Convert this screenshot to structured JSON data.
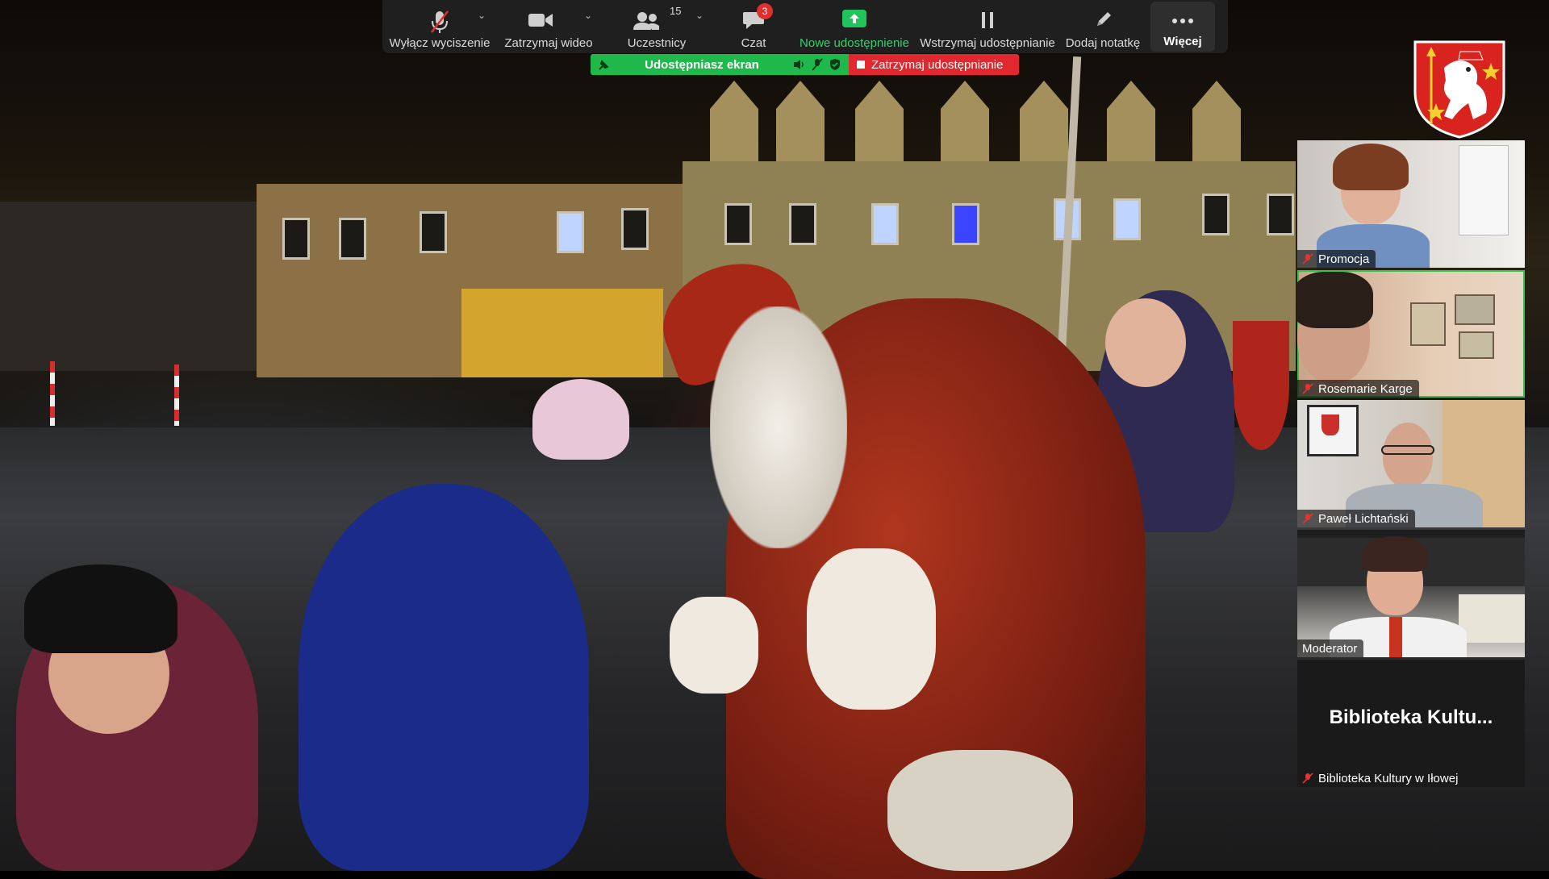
{
  "toolbar": {
    "mute": {
      "label": "Wyłącz wyciszenie",
      "icon": "microphone-muted-icon"
    },
    "video": {
      "label": "Zatrzymaj wideo",
      "icon": "video-camera-icon"
    },
    "participants": {
      "label": "Uczestnicy",
      "count": "15",
      "icon": "participants-icon"
    },
    "chat": {
      "label": "Czat",
      "badge": "3",
      "icon": "chat-icon"
    },
    "new_share": {
      "label": "Nowe udostępnienie",
      "icon": "share-arrow-icon"
    },
    "pause_share": {
      "label": "Wstrzymaj udostępnianie",
      "icon": "pause-icon"
    },
    "annotate": {
      "label": "Dodaj notatkę",
      "icon": "pencil-icon"
    },
    "more": {
      "label": "Więcej",
      "icon": "more-dots-icon"
    }
  },
  "share_banner": {
    "status": "Udostępniasz ekran",
    "stop_label": "Zatrzymaj udostępnianie"
  },
  "participants": [
    {
      "name": "Promocja",
      "muted": true,
      "active_speaker": false
    },
    {
      "name": "Rosemarie Karge",
      "muted": true,
      "active_speaker": true
    },
    {
      "name": "Paweł Lichtański",
      "muted": true,
      "active_speaker": false
    },
    {
      "name": "Moderator",
      "muted": false,
      "active_speaker": false
    },
    {
      "name": "Biblioteka Kultury w Iłowej",
      "display": "Biblioteka  Kultu...",
      "muted": true,
      "video": false
    }
  ],
  "colors": {
    "toolbar_bg": "#1f1f1f",
    "share_green": "#1fb84a",
    "stop_red": "#e0282e",
    "active_speaker": "#36c24b",
    "new_share_text": "#33d36b"
  }
}
